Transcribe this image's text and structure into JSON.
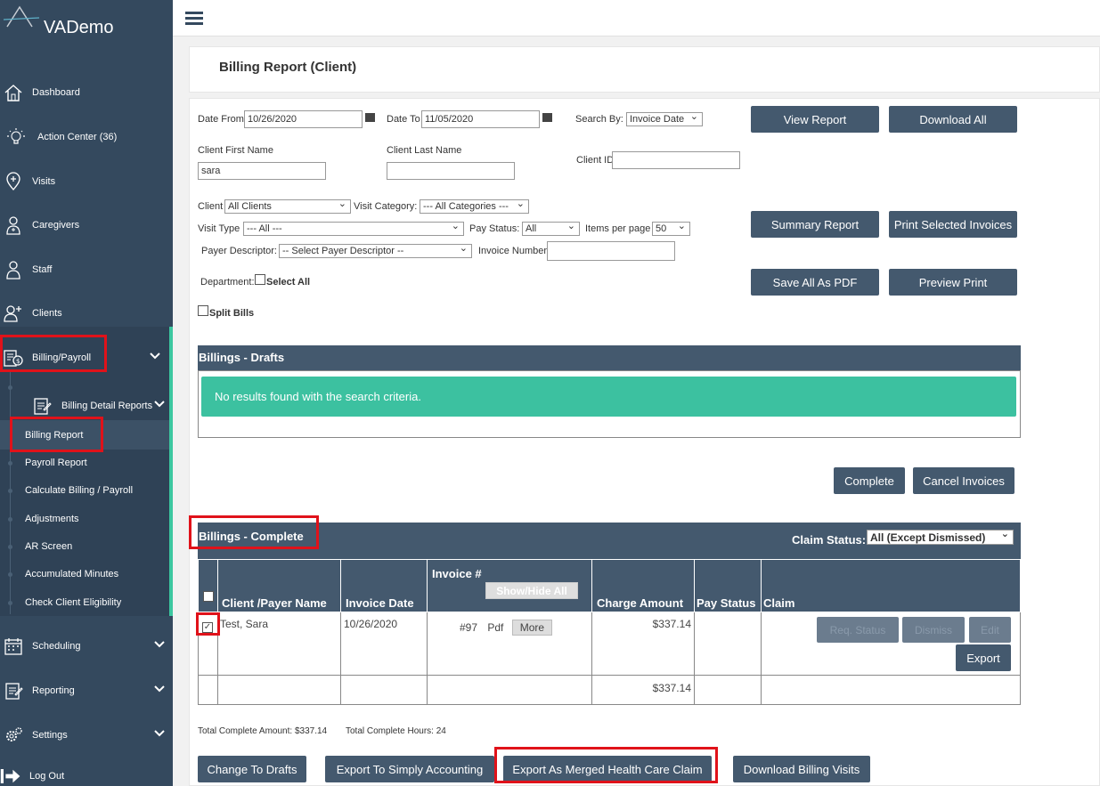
{
  "app": {
    "name": "VADemo"
  },
  "sidebar": {
    "items": [
      {
        "label": "Dashboard",
        "icon": "home-icon"
      },
      {
        "label": "Action Center (36)",
        "icon": "lightbulb-icon"
      },
      {
        "label": "Visits",
        "icon": "map-pin-icon"
      },
      {
        "label": "Caregivers",
        "icon": "caregiver-icon"
      },
      {
        "label": "Staff",
        "icon": "staff-icon"
      },
      {
        "label": "Clients",
        "icon": "clients-icon"
      },
      {
        "label": "Billing/Payroll",
        "icon": "billing-icon"
      },
      {
        "label": "Scheduling",
        "icon": "calendar-icon"
      },
      {
        "label": "Reporting",
        "icon": "reporting-icon"
      },
      {
        "label": "Settings",
        "icon": "gear-icon"
      },
      {
        "label": "Log Out",
        "icon": "logout-icon"
      }
    ],
    "billing_sub": {
      "group": "Billing Detail Reports",
      "items": [
        "Billing Report",
        "Payroll Report",
        "Calculate Billing / Payroll",
        "Adjustments",
        "AR Screen",
        "Accumulated Minutes",
        "Check Client Eligibility"
      ]
    }
  },
  "page": {
    "title": "Billing Report (Client)"
  },
  "filters": {
    "date_from_label": "Date From",
    "date_from": "10/26/2020",
    "date_to_label": "Date To",
    "date_to": "11/05/2020",
    "search_by_label": "Search By:",
    "search_by": "Invoice Date",
    "client_first_name_label": "Client First Name",
    "client_first_name": "sara",
    "client_last_name_label": "Client Last Name",
    "client_last_name": "",
    "client_id_label": "Client ID",
    "client_id": "",
    "client_label": "Client",
    "client": "All Clients",
    "visit_category_label": "Visit Category:",
    "visit_category": "--- All Categories ---",
    "visit_type_label": "Visit Type",
    "visit_type": "--- All ---",
    "pay_status_label": "Pay Status:",
    "pay_status": "All",
    "items_per_page_label": "Items per page",
    "items_per_page": "50",
    "payer_descriptor_label": "Payer Descriptor:",
    "payer_descriptor": "-- Select Payer Descriptor --",
    "invoice_number_label": "Invoice Number",
    "invoice_number": "",
    "department_label": "Department:",
    "select_all_label": "Select All",
    "split_bills_label": "Split Bills"
  },
  "buttons": {
    "view_report": "View Report",
    "download_all": "Download All",
    "summary_report": "Summary Report",
    "print_selected_invoices": "Print Selected Invoices",
    "save_all_as_pdf": "Save All As PDF",
    "preview_print": "Preview Print",
    "complete": "Complete",
    "cancel_invoices": "Cancel Invoices",
    "change_to_drafts": "Change To Drafts",
    "export_simply_accounting": "Export To Simply Accounting",
    "export_merged_claim": "Export As Merged Health Care Claim",
    "download_billing_visits": "Download Billing Visits"
  },
  "drafts": {
    "title": "Billings - Drafts",
    "empty_message": "No results found with the search criteria."
  },
  "complete": {
    "title": "Billings - Complete",
    "claim_status_label": "Claim Status:",
    "claim_status": "All (Except Dismissed)",
    "columns": {
      "client_payer": "Client /Payer Name",
      "invoice_date": "Invoice Date",
      "invoice_no": "Invoice #",
      "show_hide_all": "Show/Hide All",
      "charge_amount": "Charge Amount",
      "pay_status": "Pay Status",
      "claim": "Claim"
    },
    "rows": [
      {
        "client": "Test, Sara",
        "invoice_date": "10/26/2020",
        "invoice_no": "#97",
        "pdf": "Pdf",
        "more": "More",
        "charge": "$337.14",
        "pay_status": "",
        "actions": {
          "req_status": "Req. Status",
          "dismiss": "Dismiss",
          "edit": "Edit",
          "export": "Export"
        }
      }
    ],
    "total_charge": "$337.14",
    "total_amount_text": "Total Complete Amount: $337.14",
    "total_hours_text": "Total Complete Hours: 24"
  },
  "colors": {
    "sidebar": "#34495e",
    "accent": "#3cc7a0",
    "button": "#44596e",
    "highlight": "#e0121a"
  }
}
